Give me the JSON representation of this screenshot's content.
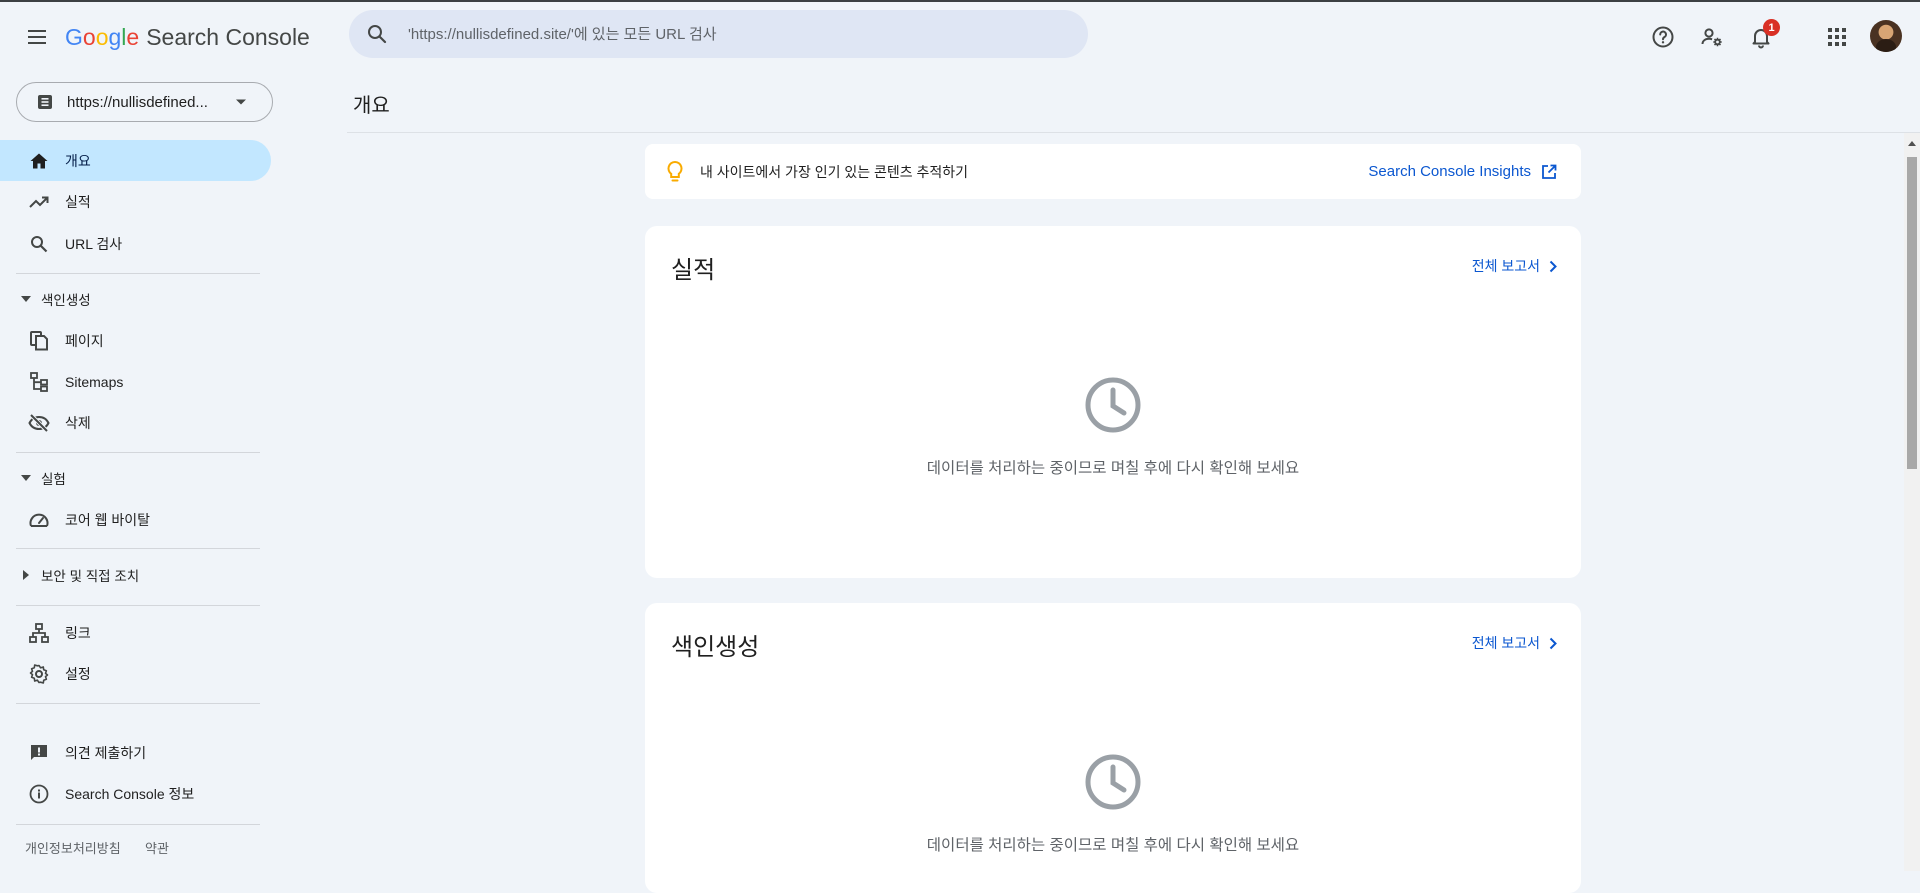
{
  "header": {
    "logo": {
      "letters": [
        "G",
        "o",
        "o",
        "g",
        "l",
        "e"
      ],
      "product": "Search Console"
    },
    "search_placeholder": "'https://nullisdefined.site/'에 있는 모든 URL 검사",
    "icons": [
      "menu-icon",
      "search-icon",
      "help-icon",
      "manage-users-icon",
      "notifications-icon",
      "apps-grid-icon",
      "account-avatar"
    ],
    "notification_count": "1"
  },
  "sidebar": {
    "property_selector": "https://nullisdefined...",
    "overview": "개요",
    "performance": "실적",
    "url_inspection": "URL 검사",
    "indexing_section": "색인생성",
    "pages": "페이지",
    "sitemaps": "Sitemaps",
    "removals": "삭제",
    "experience_section": "실험",
    "core_web_vitals": "코어 웹 바이탈",
    "security_section": "보안 및 직접 조치",
    "links": "링크",
    "settings": "설정",
    "feedback": "의견 제출하기",
    "about": "Search Console 정보",
    "privacy": "개인정보처리방침",
    "terms": "약관"
  },
  "main": {
    "page_title": "개요",
    "insights_banner": {
      "text": "내 사이트에서 가장 인기 있는 콘텐츠 추적하기",
      "link": "Search Console Insights"
    },
    "cards": [
      {
        "title": "실적",
        "link": "전체 보고서",
        "message": "데이터를 처리하는 중이므로 며칠 후에 다시 확인해 보세요"
      },
      {
        "title": "색인생성",
        "link": "전체 보고서",
        "message": "데이터를 처리하는 중이므로 며칠 후에 다시 확인해 보세요"
      }
    ]
  },
  "colors": {
    "background": "#f0f4f9",
    "active_nav": "#c2e7ff",
    "link_blue": "#0b57d0",
    "badge_red": "#d93025",
    "bulb_yellow": "#f9ab00"
  }
}
